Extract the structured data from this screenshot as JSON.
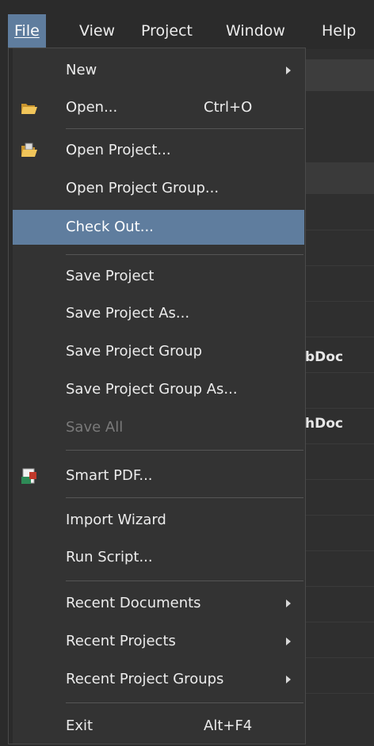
{
  "menubar": {
    "items": [
      {
        "label": "File",
        "ul": "F",
        "active": true
      },
      {
        "label": "View",
        "ul": "V"
      },
      {
        "label": "Project",
        "ul": "c"
      },
      {
        "label": "Window",
        "ul": "W"
      },
      {
        "label": "Help",
        "ul": "H"
      }
    ]
  },
  "background": {
    "doc1": "bDoc",
    "doc2": "hDoc"
  },
  "file_menu": {
    "items": [
      {
        "label": "New",
        "submenu": true
      },
      {
        "label": "Open...",
        "shortcut": "Ctrl+O",
        "icon": "open-folder-icon"
      },
      {
        "label": "Open Project...",
        "icon": "open-project-icon"
      },
      {
        "label": "Open Project Group..."
      },
      {
        "label": "Check Out...",
        "highlighted": true
      },
      {
        "label": "Save Project"
      },
      {
        "label": "Save Project As..."
      },
      {
        "label": "Save Project Group"
      },
      {
        "label": "Save Project Group As..."
      },
      {
        "label": "Save All",
        "disabled": true
      },
      {
        "label": "Smart PDF...",
        "icon": "smart-pdf-icon"
      },
      {
        "label": "Import Wizard"
      },
      {
        "label": "Run Script..."
      },
      {
        "label": "Recent Documents",
        "submenu": true
      },
      {
        "label": "Recent Projects",
        "submenu": true
      },
      {
        "label": "Recent Project Groups",
        "submenu": true
      },
      {
        "label": "Exit",
        "shortcut": "Alt+F4"
      }
    ]
  },
  "colors": {
    "highlight": "#5f7d9e",
    "menu_bg": "#333333",
    "disabled_text": "#7a7a7a"
  }
}
